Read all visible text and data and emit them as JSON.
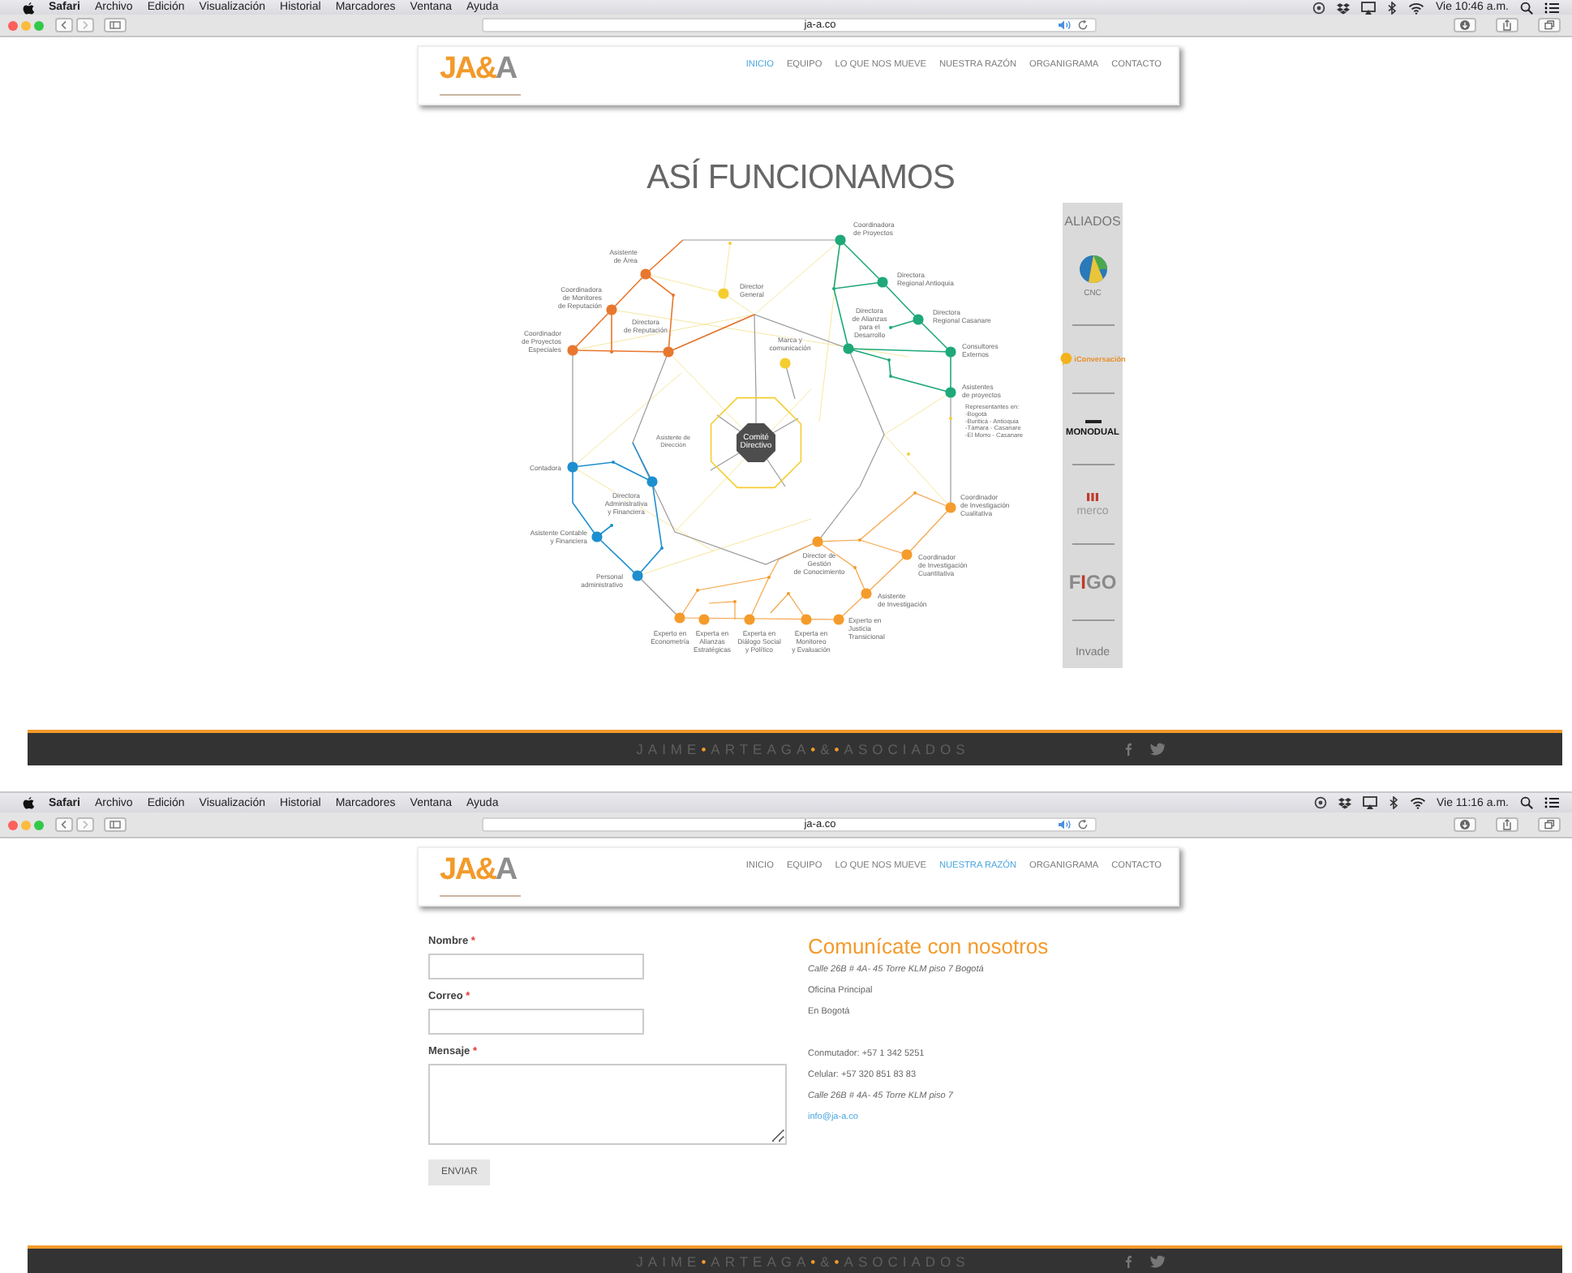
{
  "screens": [
    {
      "menubar": {
        "app": "Safari",
        "menus": [
          "Archivo",
          "Edición",
          "Visualización",
          "Historial",
          "Marcadores",
          "Ventana",
          "Ayuda"
        ],
        "clock": "Vie 10:46 a.m."
      },
      "toolbar": {
        "url": "ja-a.co"
      },
      "site": {
        "logo": "JA&A",
        "nav": [
          {
            "label": "INICIO",
            "selected": true
          },
          {
            "label": "EQUIPO",
            "selected": false
          },
          {
            "label": "LO QUE NOS MUEVE",
            "selected": false
          },
          {
            "label": "NUESTRA RAZÓN",
            "selected": false
          },
          {
            "label": "ORGANIGRAMA",
            "selected": false
          },
          {
            "label": "CONTACTO",
            "selected": false
          }
        ]
      },
      "page": {
        "kind": "org_chart",
        "title": "ASÍ FUNCIONAMOS",
        "nodes": [
          {
            "label": "Asistente de Área",
            "kind": "node",
            "color": "#e8772e"
          },
          {
            "label": "Coordinadora de Monitores de Reputación",
            "kind": "node",
            "color": "#e8772e"
          },
          {
            "label": "Coordinador de Proyectos Especiales",
            "kind": "node",
            "color": "#e8772e"
          },
          {
            "label": "Director General",
            "kind": "node",
            "color": "#f5cd2f"
          },
          {
            "label": "Directora de Reputación",
            "kind": "node",
            "color": "#e8772e"
          },
          {
            "label": "Marca y comunicación",
            "kind": "node",
            "color": "#f5cd2f"
          },
          {
            "label": "Asistente de Dirección",
            "kind": "note"
          },
          {
            "label": "Comité Directivo",
            "kind": "center",
            "color": "#4d4d4d"
          },
          {
            "label": "Contadora",
            "kind": "node",
            "color": "#1d8fcf"
          },
          {
            "label": "Directora Administrativa y Financiera",
            "kind": "node",
            "color": "#1d8fcf"
          },
          {
            "label": "Asistente Contable y Financiera",
            "kind": "node",
            "color": "#1d8fcf"
          },
          {
            "label": "Personal administrativo",
            "kind": "node",
            "color": "#1d8fcf"
          },
          {
            "label": "Experto en Econometría",
            "kind": "node",
            "color": "#f59b2b"
          },
          {
            "label": "Experta en Alianzas Estratégicas",
            "kind": "node",
            "color": "#f59b2b"
          },
          {
            "label": "Experta en Diálogo Social y Político",
            "kind": "node",
            "color": "#f59b2b"
          },
          {
            "label": "Experta en Monitoreo y Evaluación",
            "kind": "node",
            "color": "#f59b2b"
          },
          {
            "label": "Experto en Justicia Transicional",
            "kind": "node",
            "color": "#f59b2b"
          },
          {
            "label": "Director de Gestión de Conocimiento",
            "kind": "node",
            "color": "#f59b2b"
          },
          {
            "label": "Asistente de Investigación",
            "kind": "node",
            "color": "#f59b2b"
          },
          {
            "label": "Coordinador de Investigación Cuantitativa",
            "kind": "node",
            "color": "#f59b2b"
          },
          {
            "label": "Coordinador de Investigación Cualitativa",
            "kind": "node",
            "color": "#f59b2b"
          },
          {
            "label": "Coordinadora de Proyectos",
            "kind": "node",
            "color": "#1fa878"
          },
          {
            "label": "Directora Regional Antioquia",
            "kind": "node",
            "color": "#1fa878"
          },
          {
            "label": "Directora de Alianzas para el Desarrollo",
            "kind": "node",
            "color": "#1fa878"
          },
          {
            "label": "Directora Regional Casanare",
            "kind": "node",
            "color": "#1fa878"
          },
          {
            "label": "Consultores Externos",
            "kind": "node",
            "color": "#1fa878"
          },
          {
            "label": "Asistentes de proyectos",
            "kind": "node",
            "color": "#1fa878"
          },
          {
            "label": "Representantes en: -Bogotá -Buriticá - Antioquia -Támara - Casanare -El Morro - Casanare",
            "kind": "note"
          }
        ],
        "partners_panel": {
          "title": "ALIADOS",
          "partners": [
            {
              "kind": "circle_logo",
              "name": "CNC"
            },
            {
              "kind": "bubble_logo",
              "name": "iConversación"
            },
            {
              "kind": "wordmark_bar",
              "name": "MONODUAL"
            },
            {
              "kind": "bars_wordmark",
              "name": "merco"
            },
            {
              "kind": "bold_wordmark",
              "name": "FIGO"
            },
            {
              "kind": "wordmark",
              "name": "Invade"
            }
          ]
        }
      },
      "footer": {
        "brand_words": [
          "JAIME",
          "ARTEAGA",
          "&",
          "ASOCIADOS"
        ],
        "separator": "•"
      }
    },
    {
      "menubar": {
        "app": "Safari",
        "menus": [
          "Archivo",
          "Edición",
          "Visualización",
          "Historial",
          "Marcadores",
          "Ventana",
          "Ayuda"
        ],
        "clock": "Vie 11:16 a.m."
      },
      "toolbar": {
        "url": "ja-a.co"
      },
      "site": {
        "logo": "JA&A",
        "nav": [
          {
            "label": "INICIO",
            "selected": false
          },
          {
            "label": "EQUIPO",
            "selected": false
          },
          {
            "label": "LO QUE NOS MUEVE",
            "selected": false
          },
          {
            "label": "NUESTRA RAZÓN",
            "selected": true
          },
          {
            "label": "ORGANIGRAMA",
            "selected": false
          },
          {
            "label": "CONTACTO",
            "selected": false
          }
        ]
      },
      "page": {
        "kind": "contact",
        "fields": [
          {
            "label": "Nombre",
            "marker": "*",
            "kind": "input"
          },
          {
            "label": "Correo",
            "marker": "*",
            "kind": "input"
          },
          {
            "label": "Mensaje",
            "marker": "*",
            "kind": "textarea"
          }
        ],
        "submit": "ENVIAR",
        "info": {
          "heading": "Comunícate con nosotros",
          "blocks": [
            {
              "lines": [
                {
                  "text": "Calle 26B # 4A- 45 Torre KLM piso 7 Bogotá",
                  "kind": "italic"
                },
                {
                  "text": "Oficina Principal",
                  "kind": "plain"
                },
                {
                  "text": "En Bogotá",
                  "kind": "plain"
                }
              ]
            },
            {
              "lines": [
                {
                  "text": "Conmutador: +57 1 342 5251",
                  "kind": "plain"
                },
                {
                  "text": "Celular: +57 320 851 83 83",
                  "kind": "plain"
                },
                {
                  "text": "Calle 26B # 4A- 45 Torre KLM piso 7",
                  "kind": "italic"
                },
                {
                  "text": "info@ja-a.co",
                  "kind": "link"
                }
              ]
            }
          ]
        }
      },
      "footer": {
        "brand_words": [
          "JAIME",
          "ARTEAGA",
          "&",
          "ASOCIADOS"
        ],
        "separator": "•"
      }
    }
  ]
}
